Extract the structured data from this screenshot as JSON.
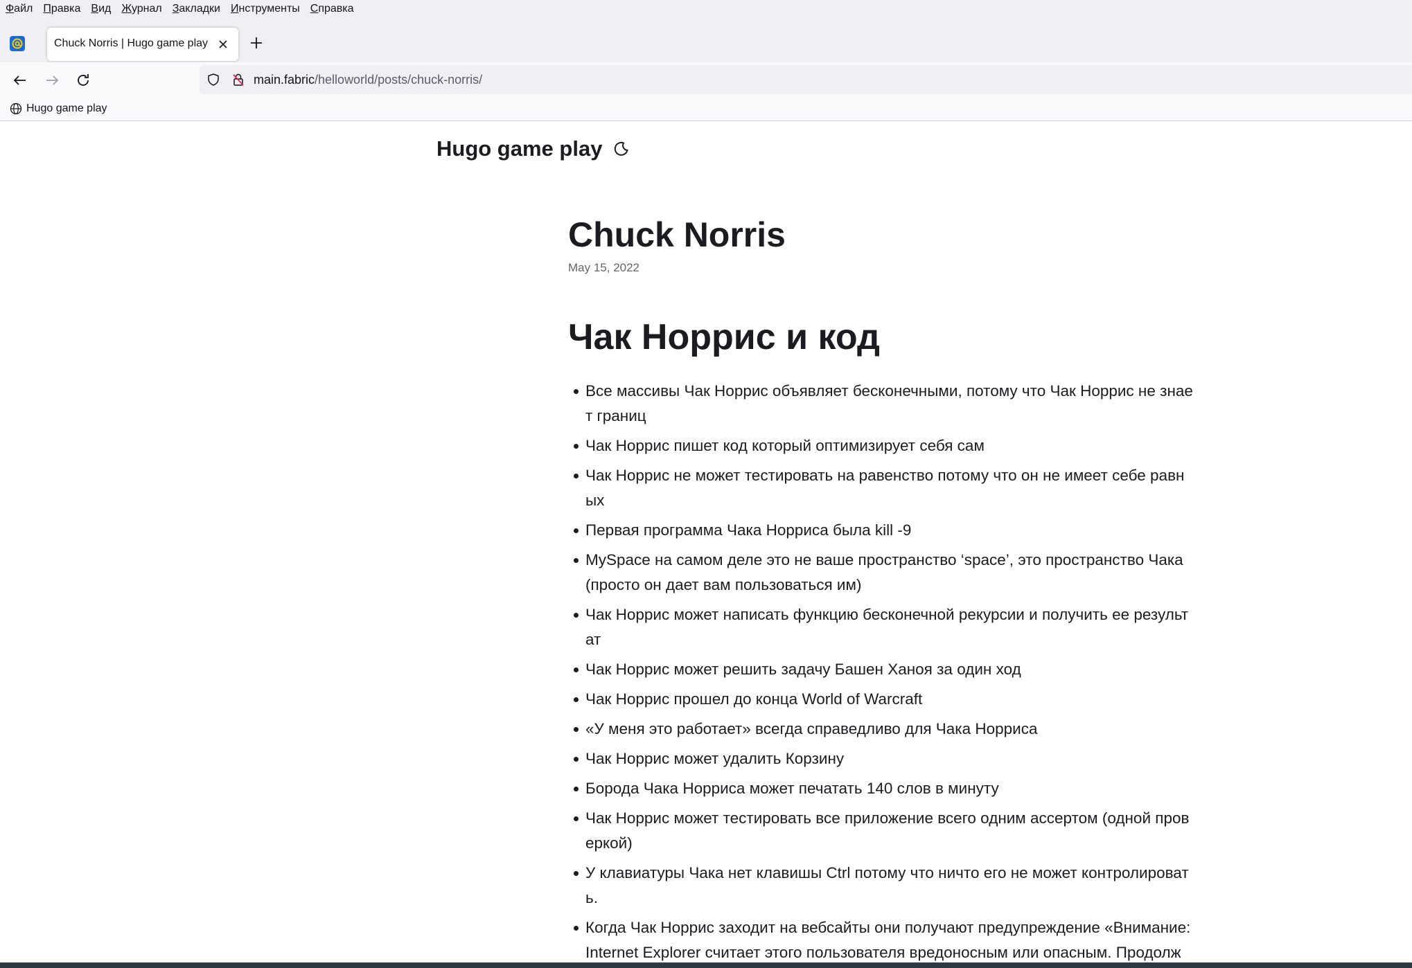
{
  "menubar": {
    "items": [
      {
        "first": "Ф",
        "rest": "айл"
      },
      {
        "first": "П",
        "rest": "равка"
      },
      {
        "first": "В",
        "rest": "ид"
      },
      {
        "first": "Ж",
        "rest": "урнал"
      },
      {
        "first": "З",
        "rest": "акладки"
      },
      {
        "first": "И",
        "rest": "нструменты"
      },
      {
        "first": "С",
        "rest": "правка"
      }
    ]
  },
  "tabs": {
    "active_title": "Chuck Norris | Hugo game play"
  },
  "urlbar": {
    "host": "main.fabric",
    "path": "/helloworld/posts/chuck-norris/"
  },
  "bookmarks": {
    "item_label": "Hugo game play"
  },
  "site": {
    "title": "Hugo game play"
  },
  "post": {
    "title": "Chuck Norris",
    "date": "May 15, 2022",
    "heading": "Чак Норрис и код",
    "items": [
      "Все массивы Чак Норрис объявляет бесконечными, потому что Чак Норрис не знает границ",
      "Чак Норрис пишет код который оптимизирует себя сам",
      "Чак Норрис не может тестировать на равенство потому что он не имеет себе равных",
      "Первая программа Чака Норриса была kill -9",
      "MySpace на самом деле это не ваше пространство ‘space’, это пространство Чака (просто он дает вам пользоваться им)",
      "Чак Норрис может написать функцию бесконечной рекурсии и получить ее результат",
      "Чак Норрис может решить задачу Башен Ханоя за один ход",
      "Чак Норрис прошел до конца World of Warcraft",
      "«У меня это работает» всегда справедливо для Чака Норриса",
      "Чак Норрис может удалить Корзину",
      "Борода Чака Норриса может печатать 140 слов в минуту",
      "Чак Норрис может тестировать все приложение всего одним ассертом (одной проверкой)",
      "У клавиатуры Чака нет клавишы Ctrl потому что ничто его не может контролировать.",
      "Когда Чак Норрис заходит на вебсайты они получают предупреждение «Внимание: Internet Explorer считает этого пользователя вредоносным или опасным. Продолж"
    ]
  }
}
